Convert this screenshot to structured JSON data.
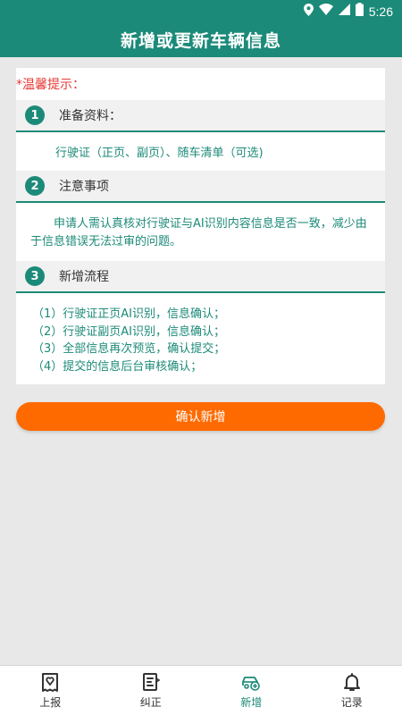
{
  "status": {
    "time": "5:26"
  },
  "header": {
    "title": "新增或更新车辆信息"
  },
  "tip": "*温馨提示：",
  "sections": [
    {
      "number": "1",
      "title": "准备资料：",
      "body": "行驶证（正页、副页）、随车清单（可选)"
    },
    {
      "number": "2",
      "title": "注意事项",
      "body": "申请人需认真核对行驶证与AI识别内容信息是否一致，减少由于信息错误无法过审的问题。"
    },
    {
      "number": "3",
      "title": "新增流程",
      "steps": [
        "（1）行驶证正页AI识别，信息确认；",
        "（2）行驶证副页AI识别，信息确认；",
        "（3）全部信息再次预览，确认提交；",
        "（4）提交的信息后台审核确认；"
      ]
    }
  ],
  "confirm_button": "确认新增",
  "tabs": [
    {
      "label": "上报",
      "icon": "report-icon",
      "active": false
    },
    {
      "label": "纠正",
      "icon": "correct-icon",
      "active": false
    },
    {
      "label": "新增",
      "icon": "car-add-icon",
      "active": true
    },
    {
      "label": "记录",
      "icon": "bell-icon",
      "active": false
    }
  ],
  "colors": {
    "primary": "#1c8a78",
    "accent": "#ff6a00",
    "tip": "#e53935"
  }
}
